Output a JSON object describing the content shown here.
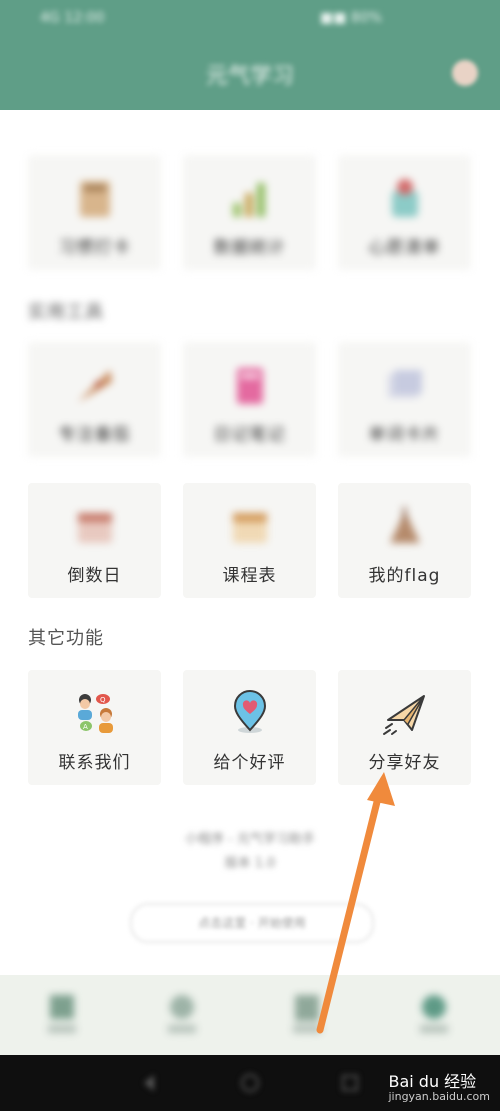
{
  "status_bar": {
    "left_text": "4G 12:00",
    "right_text": "■■ 80%"
  },
  "header": {
    "title": "元气学习"
  },
  "rows": [
    {
      "cards": [
        {
          "label": "习惯打卡",
          "icon": "book-icon"
        },
        {
          "label": "数据统计",
          "icon": "chart-icon"
        },
        {
          "label": "心愿清单",
          "icon": "jar-icon"
        }
      ]
    }
  ],
  "section_tools": {
    "title": "实用工具"
  },
  "tools_cards": [
    {
      "label": "专注番茄",
      "icon": "pizza-icon"
    },
    {
      "label": "日记笔记",
      "icon": "notebook-icon"
    },
    {
      "label": "单词卡片",
      "icon": "cards-icon"
    },
    {
      "label": "倒数日",
      "icon": "calendar-icon"
    },
    {
      "label": "课程表",
      "icon": "schedule-icon"
    },
    {
      "label": "我的flag",
      "icon": "flag-icon"
    }
  ],
  "section_other": {
    "title": "其它功能"
  },
  "other_cards": [
    {
      "label": "联系我们",
      "icon": "contact-icon"
    },
    {
      "label": "给个好评",
      "icon": "heart-pin-icon"
    },
    {
      "label": "分享好友",
      "icon": "paper-plane-icon"
    }
  ],
  "footer": {
    "line1": "小程序 - 元气学习助手",
    "line2": "版本 1.0",
    "pill": "点击这里 · 开始使用"
  },
  "tabbar": {
    "tabs": [
      "首页",
      "统计",
      "我的",
      "设置"
    ]
  },
  "watermark": {
    "brand": "Bai du 经验",
    "url": "jingyan.baidu.com"
  },
  "colors": {
    "header": "#5f9e87",
    "card_bg": "#f6f6f4",
    "arrow": "#f08a3c"
  }
}
